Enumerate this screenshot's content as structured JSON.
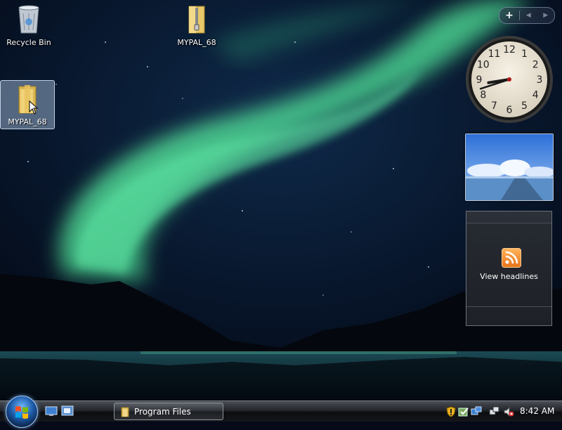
{
  "desktop": {
    "icons": [
      {
        "label": "Recycle Bin"
      },
      {
        "label": "MYPAL_68"
      },
      {
        "label": "MYPAL_68"
      }
    ]
  },
  "sidebar": {
    "controls": {
      "add": "+",
      "prev": "◀",
      "next": "▶"
    },
    "clock": {
      "numbers": [
        "12",
        "1",
        "2",
        "3",
        "4",
        "5",
        "6",
        "7",
        "8",
        "9",
        "10",
        "11"
      ],
      "hour": 8,
      "minute": 42
    },
    "feeds": {
      "label": "View headlines"
    }
  },
  "taskbar": {
    "task_button": {
      "label": "Program Files"
    },
    "clock": "8:42 AM"
  },
  "colors": {
    "accent": "#1e5aa8",
    "aurora": "#3fd08a"
  },
  "icons": [
    "recycle-bin-icon",
    "zipped-folder-icon",
    "folder-icon",
    "cursor-icon",
    "rss-icon",
    "windows-logo-icon",
    "show-desktop-icon",
    "switch-windows-icon",
    "shield-icon",
    "network-icon",
    "volume-muted-icon"
  ]
}
